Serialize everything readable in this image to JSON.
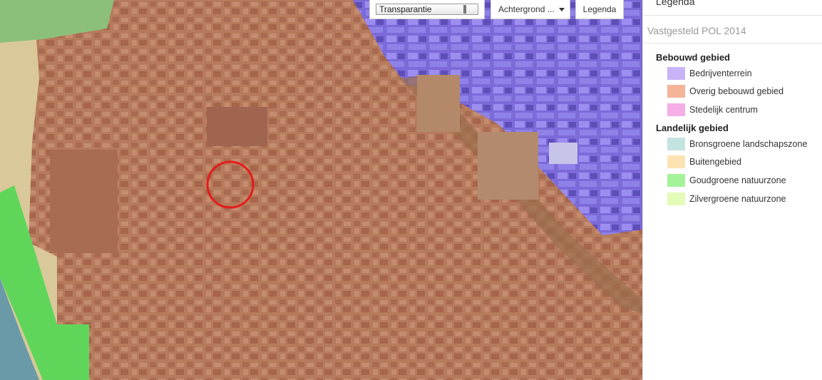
{
  "toolbar": {
    "transparency_label": "Transparantie",
    "transparency_value": 0.9,
    "background_label": "Achtergrond ...",
    "legend_label": "Legenda"
  },
  "panel": {
    "title": "Legenda",
    "layer_title": "Vastgesteld POL 2014",
    "groups": [
      {
        "name": "Bebouwd gebied",
        "items": [
          {
            "label": "Bedrijventerrein",
            "color": "#c9b3f7"
          },
          {
            "label": "Overig bebouwd gebied",
            "color": "#f4b49a"
          },
          {
            "label": "Stedelijk centrum",
            "color": "#f5aee6"
          }
        ]
      },
      {
        "name": "Landelijk gebied",
        "items": [
          {
            "label": "Bronsgroene landschapszone",
            "color": "#c3e3e1"
          },
          {
            "label": "Buitengebied",
            "color": "#fde3b3"
          },
          {
            "label": "Goudgroene natuurzone",
            "color": "#a4f39a"
          },
          {
            "label": "Zilvergroene natuurzone",
            "color": "#e4fbb8"
          }
        ]
      }
    ]
  },
  "map": {
    "colors": {
      "bebouwd": "#b97a5c",
      "bedrijventerrein": "#7f6be0",
      "buitengebied": "#d9c89a",
      "goudgroen": "#5fd65a",
      "water": "#6a9aa8",
      "marker": "#e51b1b"
    }
  }
}
